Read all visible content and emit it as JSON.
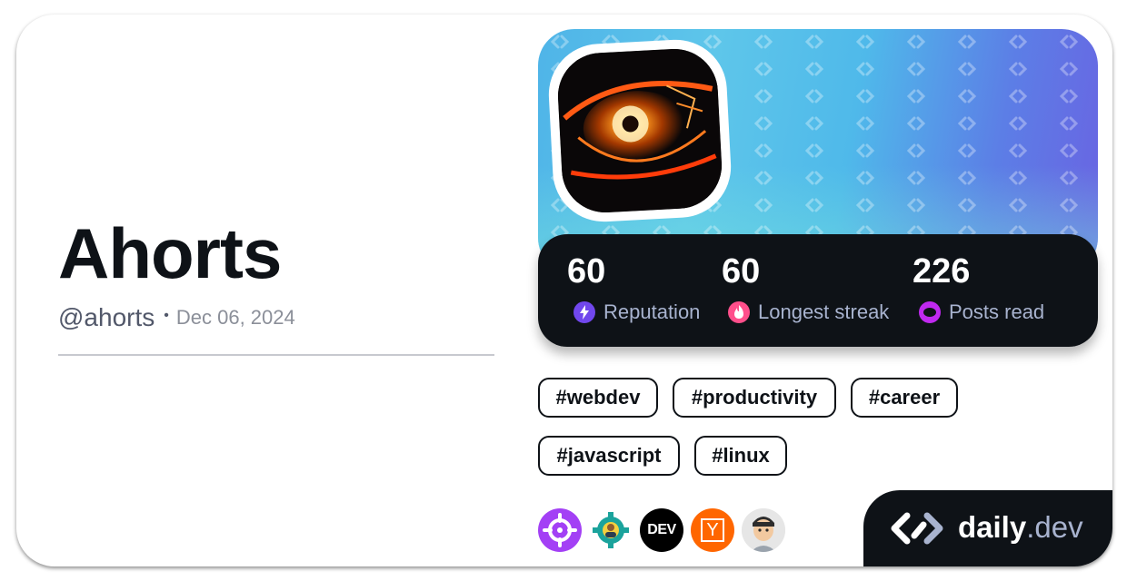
{
  "profile": {
    "name": "Ahorts",
    "handle": "@ahorts",
    "separator": "•",
    "joined": "Dec 06, 2024"
  },
  "stats": [
    {
      "value": "60",
      "label": "Reputation",
      "icon": "lightning-icon",
      "color": "#7147ed"
    },
    {
      "value": "60",
      "label": "Longest streak",
      "icon": "flame-icon",
      "color": "#ff4f8b"
    },
    {
      "value": "226",
      "label": "Posts read",
      "icon": "eye-icon",
      "color": "#c029f0"
    }
  ],
  "tags": [
    "#webdev",
    "#productivity",
    "#career",
    "#javascript",
    "#linux"
  ],
  "sources": [
    {
      "icon": "target-icon",
      "color": "#a340f5"
    },
    {
      "icon": "gear-avatar-icon",
      "color": "#ffffff"
    },
    {
      "icon": "dev-icon",
      "text": "DEV",
      "color": "#000000"
    },
    {
      "icon": "hacker-news-icon",
      "text": "Y",
      "color": "#ff6600"
    },
    {
      "icon": "person-avatar-icon",
      "color": "#f2c9a0"
    }
  ],
  "brand": {
    "name": "daily",
    "suffix": ".dev"
  },
  "colors": {
    "dark": "#0e1217",
    "muted": "#a8b3cf",
    "cover_start": "#4fb4e8",
    "cover_end": "#6a63e2"
  }
}
